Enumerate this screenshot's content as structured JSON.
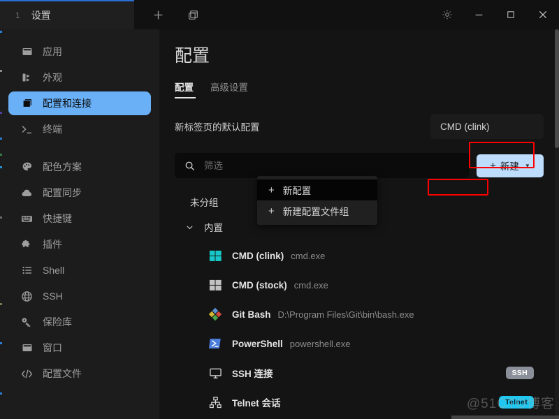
{
  "window": {
    "tab": {
      "index": "1",
      "title": "设置"
    },
    "toolbar": [
      {
        "name": "new-tab-button",
        "icon": "plus-icon"
      },
      {
        "name": "split-pane-button",
        "icon": "window-copy-icon"
      }
    ],
    "controls": [
      {
        "name": "settings-button",
        "icon": "gear-icon",
        "glyph": ""
      },
      {
        "name": "minimize-button",
        "icon": "minimize-icon",
        "glyph": "—"
      },
      {
        "name": "maximize-button",
        "icon": "maximize-icon",
        "glyph": "□"
      },
      {
        "name": "close-button",
        "icon": "close-icon",
        "glyph": "✕"
      }
    ]
  },
  "sidebar": {
    "items": [
      {
        "label": "应用",
        "icon": "window-icon",
        "active": false
      },
      {
        "label": "外观",
        "icon": "appearance-icon",
        "active": false
      },
      {
        "label": "配置和连接",
        "icon": "profiles-icon",
        "active": true
      },
      {
        "label": "终端",
        "icon": "terminal-icon",
        "active": false
      },
      {
        "label": "配色方案",
        "icon": "palette-icon",
        "active": false
      },
      {
        "label": "配置同步",
        "icon": "cloud-icon",
        "active": false
      },
      {
        "label": "快捷键",
        "icon": "keyboard-icon",
        "active": false
      },
      {
        "label": "插件",
        "icon": "puzzle-icon",
        "active": false
      },
      {
        "label": "Shell",
        "icon": "list-icon",
        "active": false
      },
      {
        "label": "SSH",
        "icon": "globe-icon",
        "active": false
      },
      {
        "label": "保险库",
        "icon": "key-icon",
        "active": false
      },
      {
        "label": "窗口",
        "icon": "window-icon",
        "active": false
      },
      {
        "label": "配置文件",
        "icon": "code-icon",
        "active": false
      }
    ]
  },
  "main": {
    "page_title": "配置",
    "tabs": [
      {
        "label": "配置",
        "active": true
      },
      {
        "label": "高级设置",
        "active": false
      }
    ],
    "default_profile": {
      "label": "新标签页的默认配置",
      "value": "CMD (clink)"
    },
    "search": {
      "placeholder": "筛选",
      "value": "",
      "icon": "search-icon"
    },
    "new_button": {
      "label": "新建",
      "plus": "+",
      "caret": "▼",
      "highlighted": true
    },
    "dropdown": {
      "items": [
        {
          "label": "新配置",
          "plus": "+",
          "highlighted": true
        },
        {
          "label": "新建配置文件组",
          "plus": "+",
          "highlighted": false
        }
      ]
    },
    "list": {
      "ungrouped_label": "未分组",
      "group": {
        "label": "内置",
        "expanded": true,
        "chevron": "⌄"
      },
      "profiles": [
        {
          "name": "CMD (clink)",
          "path": "cmd.exe",
          "icon": "windows-cyan-icon",
          "badge": ""
        },
        {
          "name": "CMD (stock)",
          "path": "cmd.exe",
          "icon": "windows-gray-icon",
          "badge": ""
        },
        {
          "name": "Git Bash",
          "path": "D:\\Program Files\\Git\\bin\\bash.exe",
          "icon": "git-icon",
          "badge": ""
        },
        {
          "name": "PowerShell",
          "path": "powershell.exe",
          "icon": "powershell-icon",
          "badge": ""
        },
        {
          "name": "SSH 连接",
          "path": "",
          "icon": "monitor-icon",
          "badge": "SSH"
        },
        {
          "name": "Telnet 会话",
          "path": "",
          "icon": "network-icon",
          "badge": "Telnet"
        }
      ]
    }
  },
  "watermark": "@51CTO博客",
  "colors": {
    "accent": "#69b0f7",
    "button": "#bedcfb",
    "highlight": "#ff0000",
    "badge_ssh": "#8b8f99",
    "badge_telnet": "#1ec8f0",
    "bg_window": "#1c1c1c",
    "bg_main": "#141414",
    "bg_titlebar": "#111111"
  }
}
